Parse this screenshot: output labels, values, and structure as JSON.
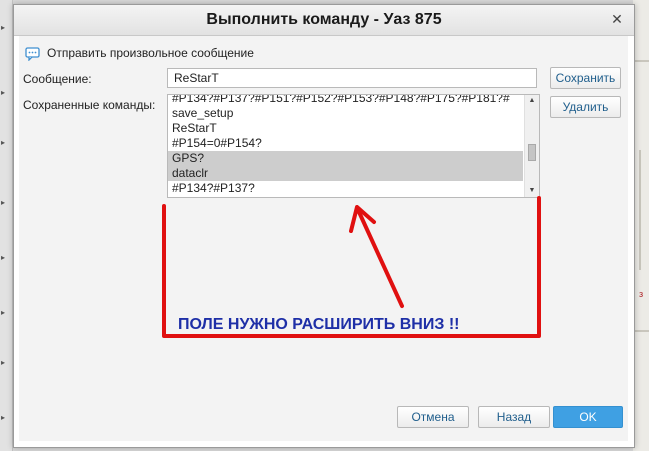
{
  "dialog": {
    "title": "Выполнить команду - Уаз 875",
    "close_icon": "✕",
    "mode_option": "Отправить произвольное сообщение",
    "message_label": "Сообщение:",
    "message_value": "ReStarT",
    "saved_label": "Сохраненные команды:",
    "save_button": "Сохранить",
    "delete_button": "Удалить",
    "saved_commands": [
      {
        "text": "#P134?#P137?#P151?#P152?#P153?#P148?#P175?#P181?#",
        "selected": false
      },
      {
        "text": "save_setup",
        "selected": false
      },
      {
        "text": "ReStarT",
        "selected": false
      },
      {
        "text": "#P154=0#P154?",
        "selected": false
      },
      {
        "text": "GPS?",
        "selected": true
      },
      {
        "text": "dataclr",
        "selected": true
      },
      {
        "text": "#P134?#P137?",
        "selected": false
      }
    ],
    "cancel_button": "Отмена",
    "back_button": "Назад",
    "ok_button": "OK"
  },
  "annotation": {
    "text": "ПОЛЕ НУЖНО РАСШИРИТЬ ВНИЗ !!",
    "color": "#e01010"
  },
  "background": {
    "map_label": "з"
  },
  "colors": {
    "accent": "#3fa0e3",
    "selection": "#cdcdcd",
    "annotation_text": "#1e2fa7"
  }
}
